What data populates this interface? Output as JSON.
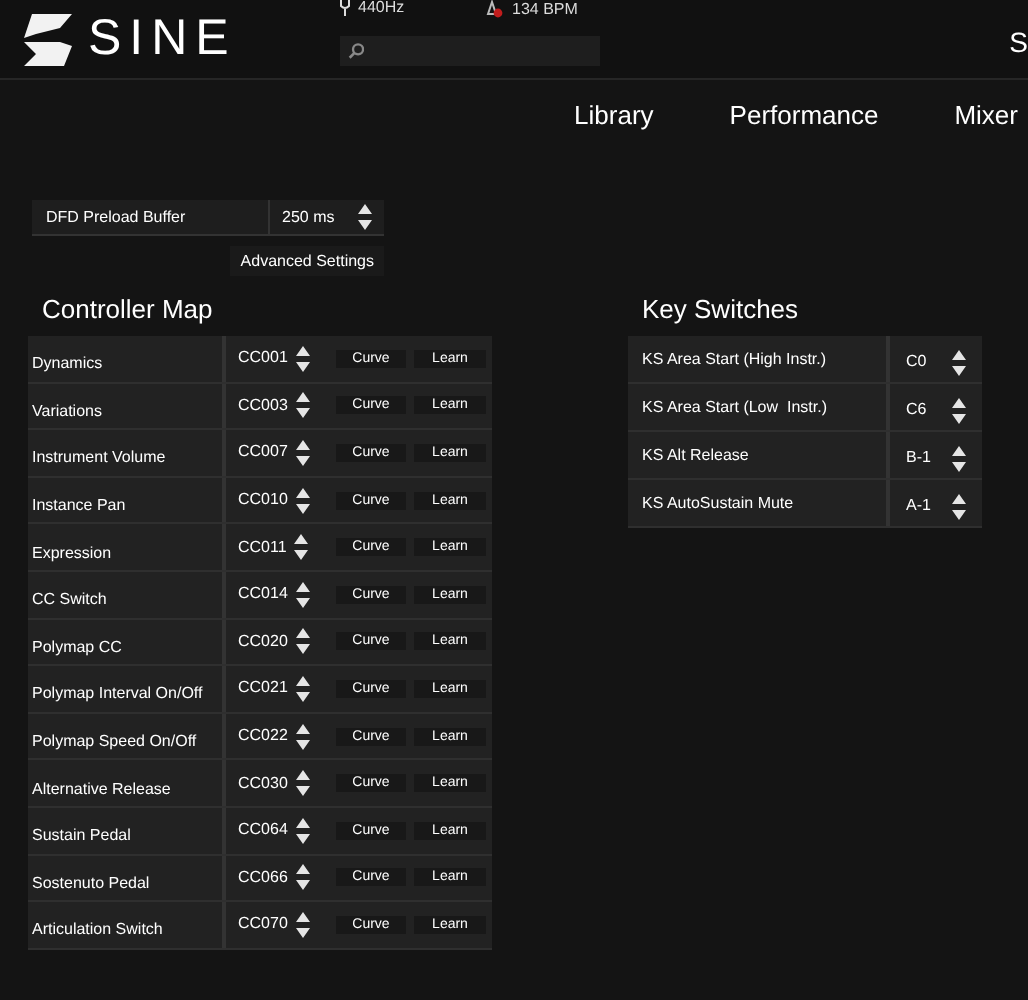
{
  "header": {
    "logo": "SINE",
    "tuning": "440Hz",
    "tempo": "134 BPM",
    "edge_text": "S"
  },
  "nav": [
    "Library",
    "Performance",
    "Mixer"
  ],
  "preload": {
    "label": "DFD Preload Buffer",
    "value": "250 ms"
  },
  "advanced_button": "Advanced Settings",
  "controller_map": {
    "title": "Controller Map",
    "rows": [
      {
        "name": "Dynamics",
        "cc": "CC001",
        "curve": "Curve",
        "learn": "Learn"
      },
      {
        "name": "Variations",
        "cc": "CC003",
        "curve": "Curve",
        "learn": "Learn"
      },
      {
        "name": "Instrument Volume",
        "cc": "CC007",
        "curve": "Curve",
        "learn": "Learn"
      },
      {
        "name": "Instance Pan",
        "cc": "CC010",
        "curve": "Curve",
        "learn": "Learn"
      },
      {
        "name": "Expression",
        "cc": "CC011",
        "curve": "Curve",
        "learn": "Learn"
      },
      {
        "name": "CC Switch",
        "cc": "CC014",
        "curve": "Curve",
        "learn": "Learn"
      },
      {
        "name": "Polymap CC",
        "cc": "CC020",
        "curve": "Curve",
        "learn": "Learn"
      },
      {
        "name": "Polymap Interval On/Off",
        "cc": "CC021",
        "curve": "Curve",
        "learn": "Learn"
      },
      {
        "name": "Polymap Speed On/Off",
        "cc": "CC022",
        "curve": "Curve",
        "learn": "Learn"
      },
      {
        "name": "Alternative Release",
        "cc": "CC030",
        "curve": "Curve",
        "learn": "Learn"
      },
      {
        "name": "Sustain Pedal",
        "cc": "CC064",
        "curve": "Curve",
        "learn": "Learn"
      },
      {
        "name": "Sostenuto Pedal",
        "cc": "CC066",
        "curve": "Curve",
        "learn": "Learn"
      },
      {
        "name": "Articulation Switch",
        "cc": "CC070",
        "curve": "Curve",
        "learn": "Learn"
      }
    ]
  },
  "key_switches": {
    "title": "Key Switches",
    "rows": [
      {
        "name": "KS Area Start (High Instr.)",
        "value": "C0"
      },
      {
        "name": "KS Area Start (Low  Instr.)",
        "value": "C6"
      },
      {
        "name": "KS Alt Release",
        "value": "B-1"
      },
      {
        "name": "KS AutoSustain Mute",
        "value": "A-1"
      }
    ]
  }
}
